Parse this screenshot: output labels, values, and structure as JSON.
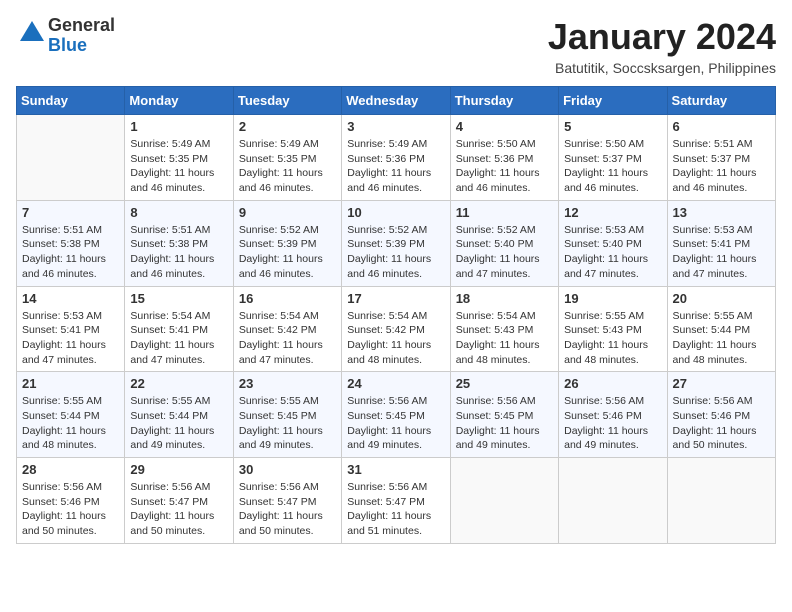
{
  "logo": {
    "line1": "General",
    "line2": "Blue"
  },
  "title": "January 2024",
  "subtitle": "Batutitik, Soccsksargen, Philippines",
  "days_header": [
    "Sunday",
    "Monday",
    "Tuesday",
    "Wednesday",
    "Thursday",
    "Friday",
    "Saturday"
  ],
  "weeks": [
    [
      {
        "day": "",
        "info": ""
      },
      {
        "day": "1",
        "info": "Sunrise: 5:49 AM\nSunset: 5:35 PM\nDaylight: 11 hours\nand 46 minutes."
      },
      {
        "day": "2",
        "info": "Sunrise: 5:49 AM\nSunset: 5:35 PM\nDaylight: 11 hours\nand 46 minutes."
      },
      {
        "day": "3",
        "info": "Sunrise: 5:49 AM\nSunset: 5:36 PM\nDaylight: 11 hours\nand 46 minutes."
      },
      {
        "day": "4",
        "info": "Sunrise: 5:50 AM\nSunset: 5:36 PM\nDaylight: 11 hours\nand 46 minutes."
      },
      {
        "day": "5",
        "info": "Sunrise: 5:50 AM\nSunset: 5:37 PM\nDaylight: 11 hours\nand 46 minutes."
      },
      {
        "day": "6",
        "info": "Sunrise: 5:51 AM\nSunset: 5:37 PM\nDaylight: 11 hours\nand 46 minutes."
      }
    ],
    [
      {
        "day": "7",
        "info": "Sunrise: 5:51 AM\nSunset: 5:38 PM\nDaylight: 11 hours\nand 46 minutes."
      },
      {
        "day": "8",
        "info": "Sunrise: 5:51 AM\nSunset: 5:38 PM\nDaylight: 11 hours\nand 46 minutes."
      },
      {
        "day": "9",
        "info": "Sunrise: 5:52 AM\nSunset: 5:39 PM\nDaylight: 11 hours\nand 46 minutes."
      },
      {
        "day": "10",
        "info": "Sunrise: 5:52 AM\nSunset: 5:39 PM\nDaylight: 11 hours\nand 46 minutes."
      },
      {
        "day": "11",
        "info": "Sunrise: 5:52 AM\nSunset: 5:40 PM\nDaylight: 11 hours\nand 47 minutes."
      },
      {
        "day": "12",
        "info": "Sunrise: 5:53 AM\nSunset: 5:40 PM\nDaylight: 11 hours\nand 47 minutes."
      },
      {
        "day": "13",
        "info": "Sunrise: 5:53 AM\nSunset: 5:41 PM\nDaylight: 11 hours\nand 47 minutes."
      }
    ],
    [
      {
        "day": "14",
        "info": "Sunrise: 5:53 AM\nSunset: 5:41 PM\nDaylight: 11 hours\nand 47 minutes."
      },
      {
        "day": "15",
        "info": "Sunrise: 5:54 AM\nSunset: 5:41 PM\nDaylight: 11 hours\nand 47 minutes."
      },
      {
        "day": "16",
        "info": "Sunrise: 5:54 AM\nSunset: 5:42 PM\nDaylight: 11 hours\nand 47 minutes."
      },
      {
        "day": "17",
        "info": "Sunrise: 5:54 AM\nSunset: 5:42 PM\nDaylight: 11 hours\nand 48 minutes."
      },
      {
        "day": "18",
        "info": "Sunrise: 5:54 AM\nSunset: 5:43 PM\nDaylight: 11 hours\nand 48 minutes."
      },
      {
        "day": "19",
        "info": "Sunrise: 5:55 AM\nSunset: 5:43 PM\nDaylight: 11 hours\nand 48 minutes."
      },
      {
        "day": "20",
        "info": "Sunrise: 5:55 AM\nSunset: 5:44 PM\nDaylight: 11 hours\nand 48 minutes."
      }
    ],
    [
      {
        "day": "21",
        "info": "Sunrise: 5:55 AM\nSunset: 5:44 PM\nDaylight: 11 hours\nand 48 minutes."
      },
      {
        "day": "22",
        "info": "Sunrise: 5:55 AM\nSunset: 5:44 PM\nDaylight: 11 hours\nand 49 minutes."
      },
      {
        "day": "23",
        "info": "Sunrise: 5:55 AM\nSunset: 5:45 PM\nDaylight: 11 hours\nand 49 minutes."
      },
      {
        "day": "24",
        "info": "Sunrise: 5:56 AM\nSunset: 5:45 PM\nDaylight: 11 hours\nand 49 minutes."
      },
      {
        "day": "25",
        "info": "Sunrise: 5:56 AM\nSunset: 5:45 PM\nDaylight: 11 hours\nand 49 minutes."
      },
      {
        "day": "26",
        "info": "Sunrise: 5:56 AM\nSunset: 5:46 PM\nDaylight: 11 hours\nand 49 minutes."
      },
      {
        "day": "27",
        "info": "Sunrise: 5:56 AM\nSunset: 5:46 PM\nDaylight: 11 hours\nand 50 minutes."
      }
    ],
    [
      {
        "day": "28",
        "info": "Sunrise: 5:56 AM\nSunset: 5:46 PM\nDaylight: 11 hours\nand 50 minutes."
      },
      {
        "day": "29",
        "info": "Sunrise: 5:56 AM\nSunset: 5:47 PM\nDaylight: 11 hours\nand 50 minutes."
      },
      {
        "day": "30",
        "info": "Sunrise: 5:56 AM\nSunset: 5:47 PM\nDaylight: 11 hours\nand 50 minutes."
      },
      {
        "day": "31",
        "info": "Sunrise: 5:56 AM\nSunset: 5:47 PM\nDaylight: 11 hours\nand 51 minutes."
      },
      {
        "day": "",
        "info": ""
      },
      {
        "day": "",
        "info": ""
      },
      {
        "day": "",
        "info": ""
      }
    ]
  ]
}
